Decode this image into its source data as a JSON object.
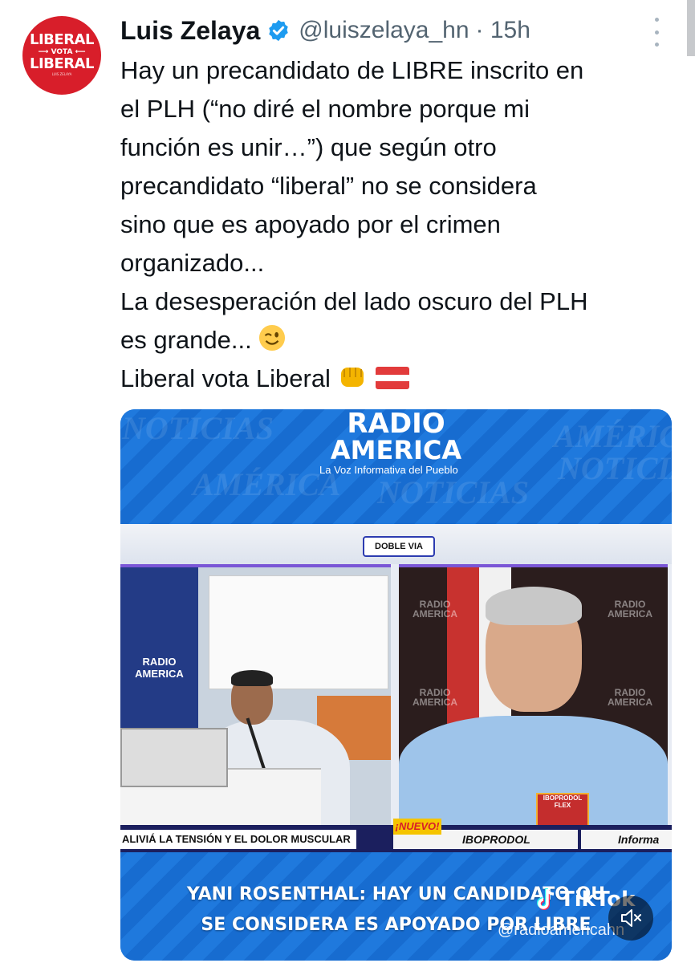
{
  "author": {
    "name": "Luis Zelaya",
    "handle": "@luiszelaya_hn",
    "time": "· 15h",
    "avatar_lines": [
      "LIBERAL",
      "VOTA",
      "LIBERAL",
      "LUIS ZELAYA"
    ]
  },
  "tweet": {
    "lines": [
      "Hay un precandidato de LIBRE inscrito en",
      "el PLH (“no diré el nombre porque mi",
      "función es unir…”) que según otro",
      "precandidato “liberal” no se considera",
      "sino que es apoyado por el crimen",
      "organizado...",
      "La desesperación del lado oscuro del PLH",
      "es grande...",
      "Liberal vota Liberal"
    ]
  },
  "video": {
    "logo_line1": "RADIO",
    "logo_line2": "AMERICA",
    "tagline": "La Voz Informativa del Pueblo",
    "watermark1": "AMÉRICA",
    "watermark2": "NOTICIAS",
    "program_badge": "DOBLE VIA",
    "studio_logo_left": "RADIO AMERICA",
    "studio_logo_right": "RADIO AMERICA",
    "ticker_left": "ALIVIÁ LA TENSIÓN Y EL DOLOR MUSCULAR",
    "ticker_new": "¡NUEVO!",
    "ticker_brand": "IBOPRODOL",
    "ticker_right": "Informa",
    "product_label": "IBOPRODOL FLEX",
    "caption_line1": "YANI ROSENTHAL: HAY UN CANDIDATO QU",
    "caption_line2": "SE CONSIDERA  ES APOYADO POR LIBRE",
    "tiktok_label": "TikTok",
    "tiktok_handle": "@radioamericahn"
  },
  "colors": {
    "verified_blue": "#1d9bf0",
    "avatar_red": "#d81e2a",
    "handle_gray": "#536471"
  }
}
